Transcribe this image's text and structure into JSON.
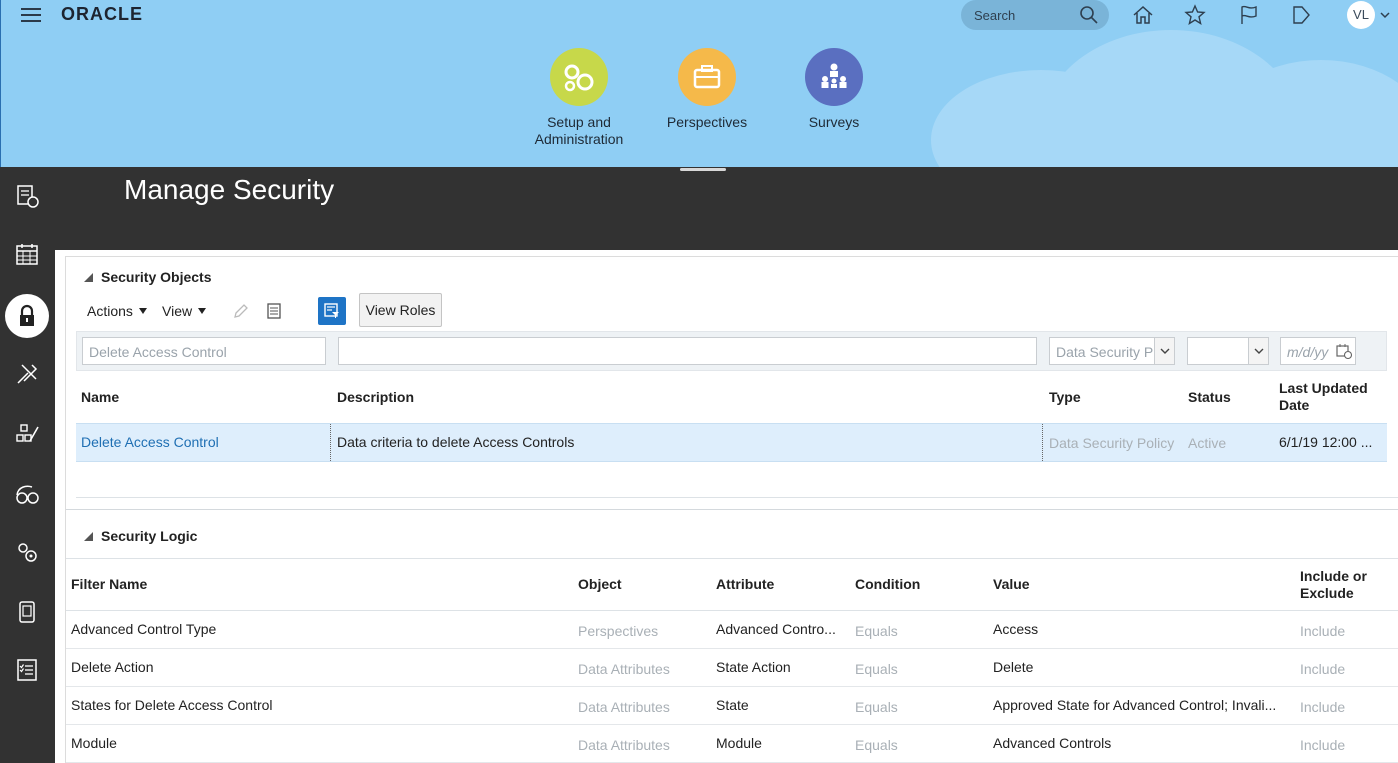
{
  "header": {
    "logo": "ORACLE",
    "search_placeholder": "Search",
    "avatar_initials": "VL"
  },
  "apps": [
    {
      "label": "Setup and Administration",
      "color": "#c7d84a",
      "icon": "gears-icon"
    },
    {
      "label": "Perspectives",
      "color": "#f5b94a",
      "icon": "briefcase-icon"
    },
    {
      "label": "Surveys",
      "color": "#5a6fc0",
      "icon": "people-icon"
    }
  ],
  "page": {
    "title": "Manage Security"
  },
  "security_objects": {
    "title": "Security Objects",
    "toolbar": {
      "actions": "Actions",
      "view": "View",
      "view_roles": "View Roles"
    },
    "filters": {
      "name": "Delete Access Control",
      "description": "",
      "type": "Data Security P",
      "status": "",
      "date_placeholder": "m/d/yy"
    },
    "columns": {
      "name": "Name",
      "description": "Description",
      "type": "Type",
      "status": "Status",
      "last_updated": "Last Updated Date"
    },
    "rows": [
      {
        "name": "Delete Access Control",
        "description": "Data criteria to delete Access Controls",
        "type": "Data Security Policy",
        "status": "Active",
        "last_updated": "6/1/19 12:00 ..."
      }
    ]
  },
  "security_logic": {
    "title": "Security Logic",
    "columns": {
      "filter_name": "Filter Name",
      "object": "Object",
      "attribute": "Attribute",
      "condition": "Condition",
      "value": "Value",
      "include": "Include or Exclude"
    },
    "rows": [
      {
        "filter_name": "Advanced Control Type",
        "object": "Perspectives",
        "attribute": "Advanced Contro...",
        "condition": "Equals",
        "value": "Access",
        "include": "Include"
      },
      {
        "filter_name": "Delete Action",
        "object": "Data Attributes",
        "attribute": "State Action",
        "condition": "Equals",
        "value": "Delete",
        "include": "Include"
      },
      {
        "filter_name": "States for Delete Access Control",
        "object": "Data Attributes",
        "attribute": "State",
        "condition": "Equals",
        "value": "Approved State for Advanced Control; Invali...",
        "include": "Include"
      },
      {
        "filter_name": "Module",
        "object": "Data Attributes",
        "attribute": "Module",
        "condition": "Equals",
        "value": "Advanced Controls",
        "include": "Include"
      }
    ]
  },
  "colors": {
    "header_bg": "#8fcef4",
    "dark_band": "#323232",
    "link": "#1f6fb3",
    "selected_row": "#deeefc",
    "primary_button": "#1e74c6"
  }
}
